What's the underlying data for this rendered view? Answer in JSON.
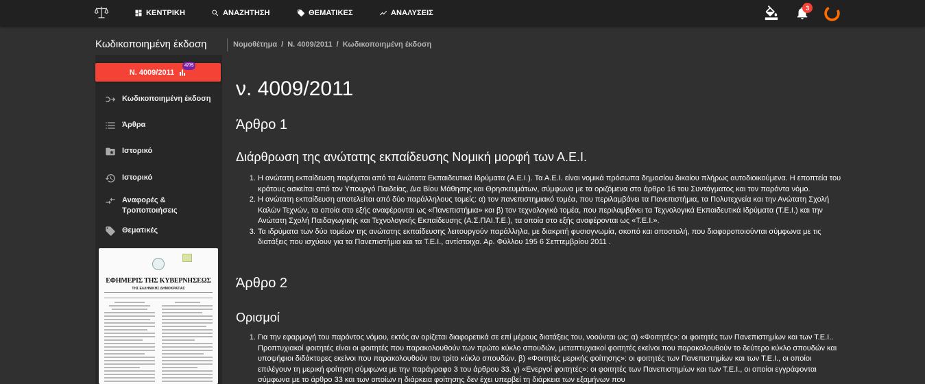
{
  "topbar": {
    "logo_icon": "scales-of-justice-icon",
    "nav": [
      {
        "label": "ΚΕΝΤΡΙΚΗ",
        "icon": "dashboard-icon"
      },
      {
        "label": "ΑΝΑΖΗΤΗΣΗ",
        "icon": "search-icon"
      },
      {
        "label": "ΘΕΜΑΤΙΚΕΣ",
        "icon": "tag-icon"
      },
      {
        "label": "ΑΝΑΛΥΣΕΙΣ",
        "icon": "trending-icon"
      }
    ],
    "notifications_count": "3",
    "colors": {
      "bar": "#212121",
      "badge": "#f44336",
      "avatar_ring": "#ff6d00"
    }
  },
  "header": {
    "page_title": "Κωδικοποιημένη έκδοση",
    "breadcrumb": [
      "Νομοθέτημα",
      "Ν. 4009/2011",
      "Κωδικοποιημένη έκδοση"
    ],
    "breadcrumb_sep": "/"
  },
  "sidebar": {
    "law_button": "Ν. 4009/2011",
    "law_badge": "4775",
    "items": [
      {
        "label": "Κωδικοποιημένη έκδοση",
        "icon": "merge-arrow-icon"
      },
      {
        "label": "Άρθρα",
        "icon": "list-icon"
      },
      {
        "label": "Ιστορικό",
        "icon": "folder-star-icon"
      },
      {
        "label": "Ιστορικό",
        "icon": "history-icon"
      },
      {
        "label": "Αναφορές & Τροποποιήσεις",
        "icon": "compare-arrows-icon"
      },
      {
        "label": "Θεματικές",
        "icon": "tag-icon"
      }
    ],
    "gazette": {
      "title": "ΕΦΗΜΕΡΙΣ ΤΗΣ ΚΥΒΕΡΝΗΣΕΩΣ",
      "subtitle": "ΤΗΣ ΕΛΛΗΝΙΚΗΣ ΔΗΜΟΚΡΑΤΙΑΣ"
    }
  },
  "main": {
    "law_title": "ν. 4009/2011",
    "articles": [
      {
        "heading": "Άρθρο 1",
        "subheading": "Διάρθρωση της ανώτατης εκπαίδευσης Νομική μορφή των Α.Ε.Ι.",
        "paragraphs": [
          "Η ανώτατη εκπαίδευση παρέχεται από τα Ανώτατα Εκπαιδευτικά Ιδρύματα (Α.Ε.Ι.). Τα Α.Ε.Ι. είναι νομικά πρόσωπα δημοσίου δικαίου πλήρως αυτοδιοικούμενα. Η εποπτεία του κράτους ασκείται από τον Υπουργό Παιδείας, Δια Βίου Μάθησης και Θρησκευμάτων, σύμφωνα με τα οριζόμενα στο άρθρο 16 του Συντάγματος και τον παρόντα νόμο.",
          "Η ανώτατη εκπαίδευση αποτελείται από δύο παράλληλους τομείς: α) τον πανεπιστημιακό τομέα, που περιλαμβάνει τα Πανεπιστήμια, τα Πολυτεχνεία και την Ανώτατη Σχολή Καλών Τεχνών, τα οποία στο εξής αναφέρονται ως «Πανεπιστήμια» και β) τον τεχνολογικό τομέα, που περιλαμβάνει τα Τεχνολογικά Εκπαιδευτικά Ιδρύματα (Τ.Ε.Ι.) και την Ανώτατη Σχολή Παιδαγωγικής και Τεχνολογικής Εκπαίδευσης (Α.Σ.ΠΑΙ.Τ.Ε.), τα οποία στο εξής αναφέρονται ως «Τ.Ε.Ι.».",
          "Τα ιδρύματα των δύο τομέων της ανώτατης εκπαίδευσης λειτουργούν παράλληλα, με διακριτή φυσιογνωμία, σκοπό και αποστολή, που διαφοροποιούνται σύμφωνα με τις διατάξεις που ισχύουν για τα Πανεπιστήμια και τα Τ.Ε.Ι., αντίστοιχα. Αρ. Φύλλου 195 6 Σεπτεμβρίου 2011 ."
        ]
      },
      {
        "heading": "Άρθρο 2",
        "subheading": "Ορισμοί",
        "paragraphs": [
          "Για την εφαρμογή του παρόντος νόμου, εκτός αν ορίζεται διαφορετικά σε επί μέρους διατάξεις του, νοούνται ως: α) «Φοιτητές»: οι φοιτητές των Πανεπιστημίων και των Τ.Ε.Ι.. Προπτυχιακοί φοιτητές είναι οι φοιτητές που παρακολουθούν των πρώτο κύκλο σπουδών, μεταπτυχιακοί φοιτητές εκείνοι που παρακολουθούν το δεύτερο κύκλο σπουδών και υποψήφιοι διδάκτορες εκείνοι που παρακολουθούν τον τρίτο κύκλο σπουδών. β) «Φοιτητές μερικής φοίτησης»: οι φοιτητές των Πανεπιστημίων και των Τ.Ε.Ι., οι οποίοι επιλέγουν τη μερική φοίτηση σύμφωνα με την παράγραφο 3 του άρθρου 33. γ) «Ενεργοί φοιτητές»: οι φοιτητές των Πανεπιστημίων και των Τ.Ε.Ι., οι οποίοι εγγράφονται σύμφωνα με το άρθρο 33 και των οποίων η διάρκεια φοίτησης δεν έχει υπερβεί τη διάρκεια των εξαμήνων που"
        ]
      }
    ]
  }
}
